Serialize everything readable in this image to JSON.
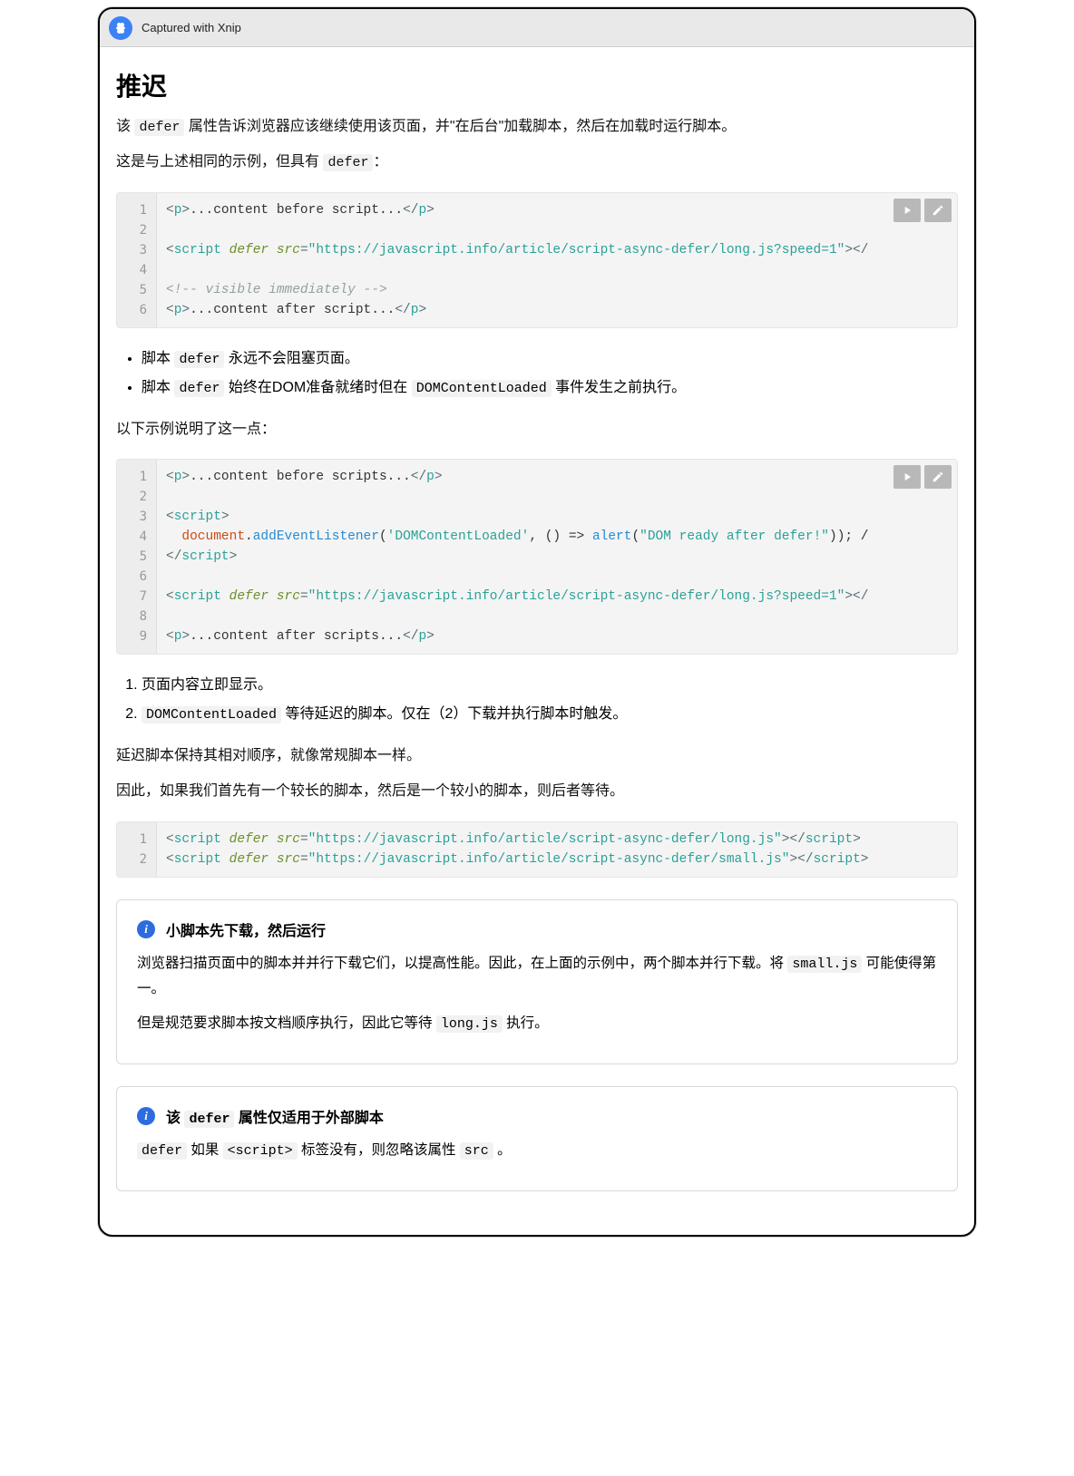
{
  "titlebar": {
    "text": "Captured with Xnip"
  },
  "heading": "推迟",
  "para1": {
    "pre": "该 ",
    "code": "defer",
    "post": " 属性告诉浏览器应该继续使用该页面，并\"在后台\"加载脚本，然后在加载时运行脚本。"
  },
  "para2": {
    "pre": "这是与上述相同的示例，但具有 ",
    "code": "defer",
    "post": "："
  },
  "code1_lines": [
    "1",
    "2",
    "3",
    "4",
    "5",
    "6"
  ],
  "bullets": {
    "b1_pre": "脚本 ",
    "b1_code": "defer",
    "b1_post": " 永远不会阻塞页面。",
    "b2_pre": "脚本 ",
    "b2_code": "defer",
    "b2_mid": " 始终在DOM准备就绪时但在 ",
    "b2_code2": "DOMContentLoaded",
    "b2_post": " 事件发生之前执行。"
  },
  "para3": "以下示例说明了这一点：",
  "code2_lines": [
    "1",
    "2",
    "3",
    "4",
    "5",
    "6",
    "7",
    "8",
    "9"
  ],
  "ol": {
    "i1": "页面内容立即显示。",
    "i2_code": "DOMContentLoaded",
    "i2_mid": " 等待延迟的脚本。仅在（2）下载并执行脚本时触发。"
  },
  "para4": "延迟脚本保持其相对顺序，就像常规脚本一样。",
  "para5": "因此，如果我们首先有一个较长的脚本，然后是一个较小的脚本，则后者等待。",
  "code3_lines": [
    "1",
    "2"
  ],
  "note1": {
    "title": "小脚本先下载，然后运行",
    "p1_pre": "浏览器扫描页面中的脚本并并行下载它们，以提高性能。因此，在上面的示例中，两个脚本并行下载。将 ",
    "p1_code": "small.js",
    "p1_post": " 可能使得第一。",
    "p2_pre": "但是规范要求脚本按文档顺序执行，因此它等待 ",
    "p2_code": "long.js",
    "p2_post": " 执行。"
  },
  "note2": {
    "title_pre": "该 ",
    "title_code": "defer",
    "title_post": " 属性仅适用于外部脚本",
    "p_pre": "defer",
    "p_mid1": " 如果 ",
    "p_code": "<script>",
    "p_mid2": " 标签没有，则忽略该属性 ",
    "p_code2": "src",
    "p_post": " 。"
  }
}
